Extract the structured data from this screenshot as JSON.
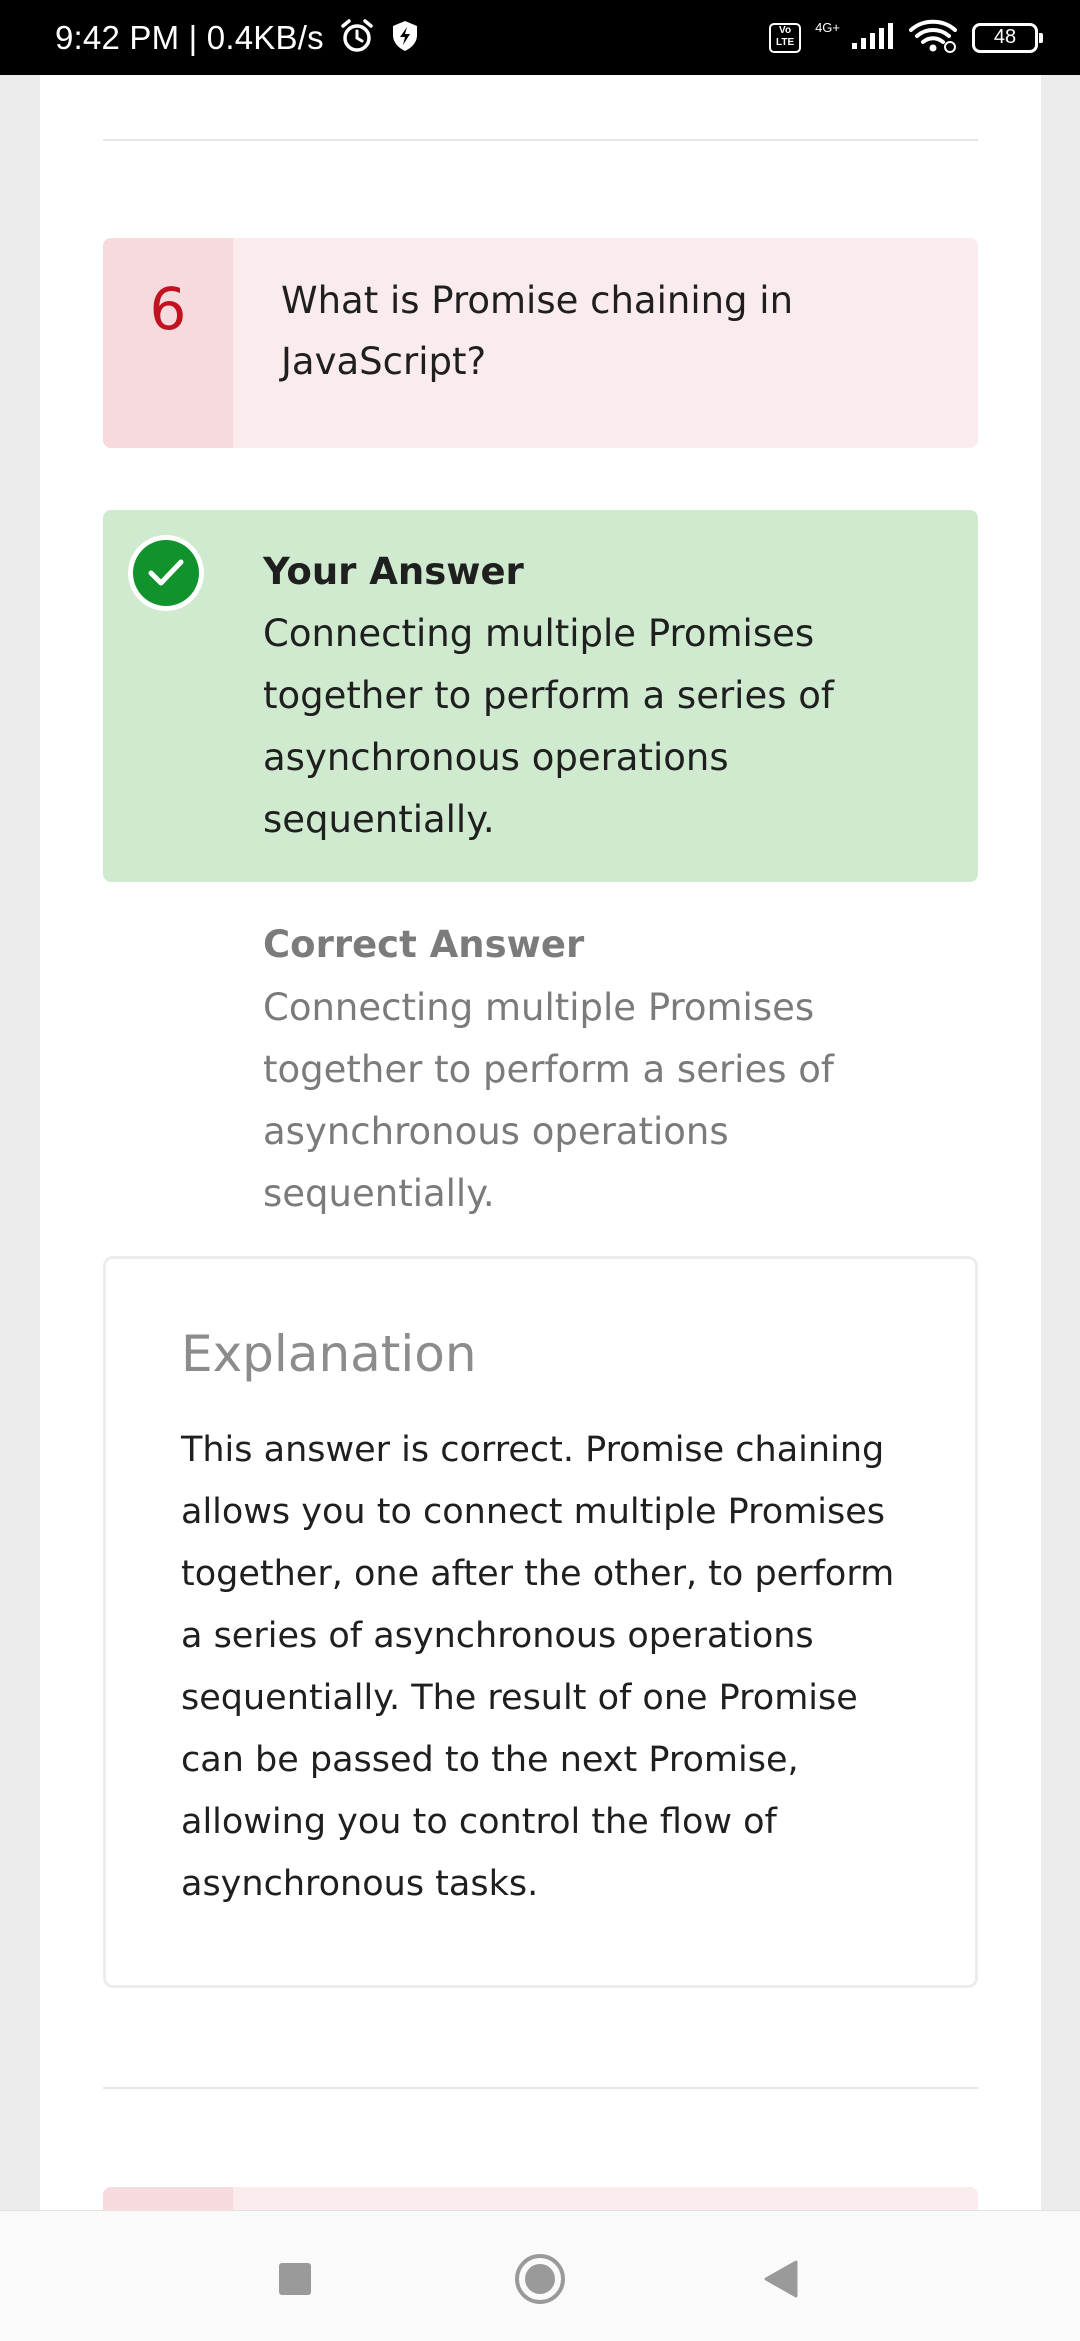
{
  "status_bar": {
    "time_speed": "9:42 PM | 0.4KB/s",
    "volte_label": "Vo\nLTE",
    "network_type": "4G+",
    "battery": "48"
  },
  "question": {
    "number": "6",
    "text": "What is Promise chaining in JavaScript?"
  },
  "your_answer": {
    "title": "Your Answer",
    "text": "Connecting multiple Promises together to perform a series of asynchronous operations sequentially."
  },
  "correct_answer": {
    "title": "Correct Answer",
    "text": "Connecting multiple Promises together to perform a series of asynchronous operations sequentially."
  },
  "explanation": {
    "title": "Explanation",
    "text": "This answer is correct. Promise chaining allows you to connect multiple Promises together, one after the other, to perform a series of asynchronous operations sequentially. The result of one Promise can be passed to the next Promise, allowing you to control the flow of asynchronous tasks."
  },
  "colors": {
    "question_accent": "#c1121f",
    "question_bg": "#faeced",
    "answer_bg": "#cfeace",
    "check_green": "#10922d"
  }
}
